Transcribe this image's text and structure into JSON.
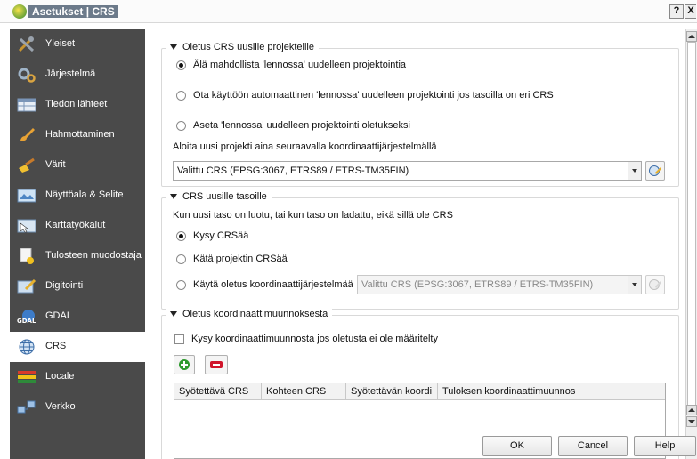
{
  "window": {
    "title": "Asetukset | CRS",
    "help_button": "?",
    "close_button": "X"
  },
  "sidebar": {
    "items": [
      {
        "label": "Yleiset",
        "icon": "tools-icon"
      },
      {
        "label": "Järjestelmä",
        "icon": "gears-icon"
      },
      {
        "label": "Tiedon lähteet",
        "icon": "table-icon"
      },
      {
        "label": "Hahmottaminen",
        "icon": "brush-icon"
      },
      {
        "label": "Värit",
        "icon": "paint-icon"
      },
      {
        "label": "Näyttöala & Selite",
        "icon": "map-view-icon"
      },
      {
        "label": "Karttatyökalut",
        "icon": "map-tools-icon"
      },
      {
        "label": "Tulosteen muodostaja",
        "icon": "composer-icon"
      },
      {
        "label": "Digitointi",
        "icon": "digitize-icon"
      },
      {
        "label": "GDAL",
        "icon": "gdal-icon"
      },
      {
        "label": "CRS",
        "icon": "globe-icon",
        "active": true
      },
      {
        "label": "Locale",
        "icon": "flags-icon"
      },
      {
        "label": "Verkko",
        "icon": "network-icon"
      }
    ]
  },
  "project_crs": {
    "title": "Oletus CRS uusille projekteille",
    "options": [
      {
        "label": "Älä mahdollista 'lennossa' uudelleen projektointia",
        "selected": true
      },
      {
        "label": "Ota käyttöön automaattinen 'lennossa' uudelleen projektointi jos tasoilla on eri CRS",
        "selected": false
      },
      {
        "label": "Aseta 'lennossa' uudelleen projektointi oletukseksi",
        "selected": false
      }
    ],
    "new_project_label": "Aloita uusi projekti aina seuraavalla koordinaattijärjestelmällä",
    "crs_value": "Valittu CRS (EPSG:3067, ETRS89 / ETRS-TM35FIN)"
  },
  "layer_crs": {
    "title": "CRS uusille tasoille",
    "description": "Kun uusi taso on luotu, tai kun taso on ladattu, eikä sillä ole CRS",
    "options": [
      {
        "label": "Kysy CRSää",
        "selected": true
      },
      {
        "label": "Kätä projektin CRSää",
        "selected": false
      },
      {
        "label": "Käytä oletus koordinaattijärjestelmää",
        "selected": false
      }
    ],
    "default_crs_value": "Valittu CRS (EPSG:3067, ETRS89 / ETRS-TM35FIN)"
  },
  "transform": {
    "title": "Oletus koordinaattimuunnoksesta",
    "ask_label": "Kysy koordinaattimuunnosta jos oletusta ei ole määritelty",
    "ask_checked": false,
    "columns": [
      "Syötettävä CRS",
      "Kohteen CRS",
      "Syötettävän koordi",
      "Tuloksen koordinaattimuunnos"
    ]
  },
  "buttons": {
    "ok": "OK",
    "cancel": "Cancel",
    "help": "Help"
  },
  "colors": {
    "sidebar_bg": "#4a4a4a",
    "add_icon": "#2e9a2e",
    "remove_icon": "#d0142a"
  }
}
